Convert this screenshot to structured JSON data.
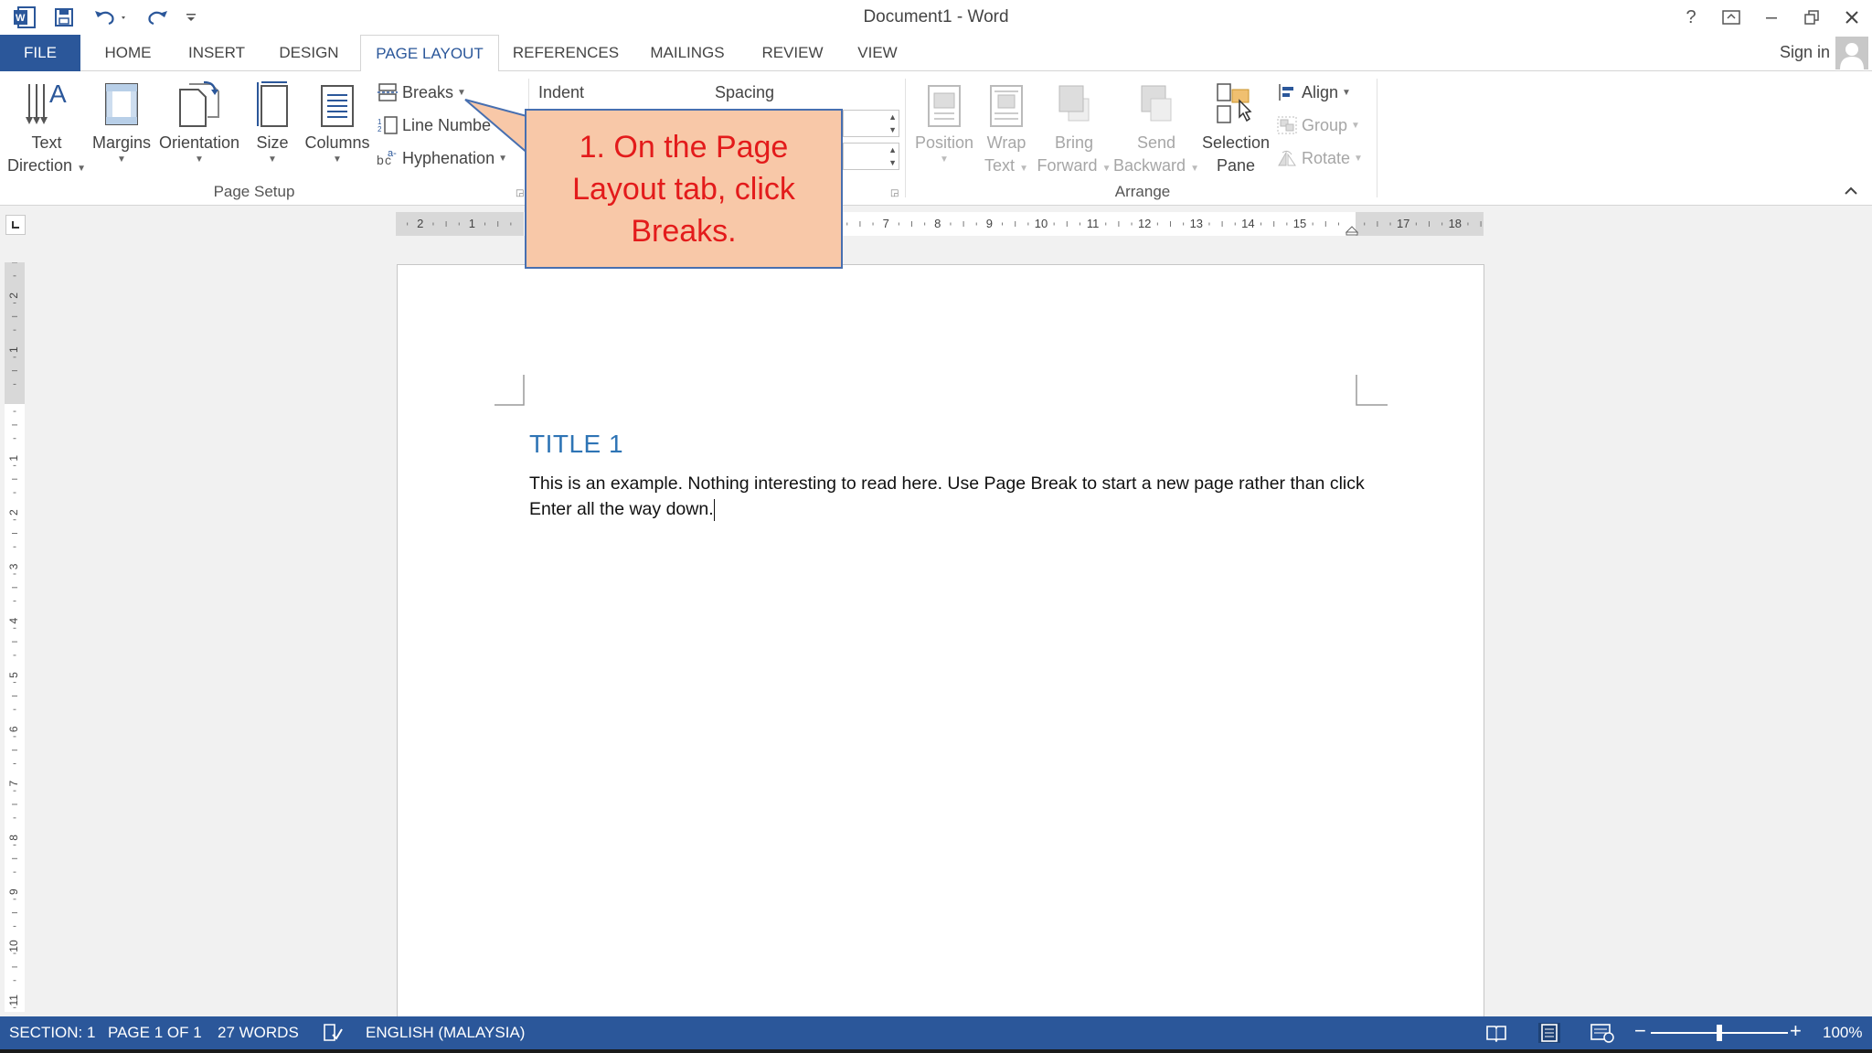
{
  "window": {
    "title": "Document1 - Word",
    "help": "?",
    "signin": "Sign in"
  },
  "tabs": {
    "file": "FILE",
    "items": [
      "HOME",
      "INSERT",
      "DESIGN",
      "PAGE LAYOUT",
      "REFERENCES",
      "MAILINGS",
      "REVIEW",
      "VIEW"
    ],
    "active": "PAGE LAYOUT"
  },
  "ribbon": {
    "page_setup": {
      "text_direction": [
        "Text",
        "Direction"
      ],
      "margins": "Margins",
      "orientation": "Orientation",
      "size": "Size",
      "columns": "Columns",
      "breaks": "Breaks",
      "line_numbers": "Line Numbe",
      "hyphenation": "Hyphenation",
      "label": "Page Setup"
    },
    "paragraph": {
      "indent": "Indent",
      "spacing": "Spacing"
    },
    "arrange": {
      "position": "Position",
      "wrap_text": [
        "Wrap",
        "Text"
      ],
      "bring_forward": [
        "Bring",
        "Forward"
      ],
      "send_backward": [
        "Send",
        "Backward"
      ],
      "selection_pane": [
        "Selection",
        "Pane"
      ],
      "align": "Align",
      "group": "Group",
      "rotate": "Rotate",
      "label": "Arrange"
    }
  },
  "ruler": {
    "h_left_ticks": [
      "2",
      "1"
    ],
    "h_right_ticks": [
      "7",
      "8",
      "9",
      "10",
      "11",
      "12",
      "13",
      "14",
      "15",
      "17",
      "18"
    ],
    "v_ticks": [
      "2",
      "1",
      "1",
      "2",
      "3",
      "4",
      "5",
      "6",
      "7",
      "8",
      "9",
      "10",
      "11"
    ]
  },
  "document": {
    "title": "TITLE 1",
    "body": "This is an example. Nothing interesting to read here. Use Page Break to start a new page rather than click Enter all the way down."
  },
  "callout": {
    "text": "1. On the Page Layout tab, click Breaks."
  },
  "status": {
    "section": "SECTION: 1",
    "page": "PAGE 1 OF 1",
    "words": "27 WORDS",
    "language": "ENGLISH (MALAYSIA)",
    "zoom": "100%",
    "zoom_level": 1.0
  },
  "colors": {
    "accent": "#2b579a",
    "callout_fill": "#f8c8a8",
    "callout_border": "#476fb0",
    "callout_text": "#e31b1b",
    "title_blue": "#2e74b5"
  }
}
